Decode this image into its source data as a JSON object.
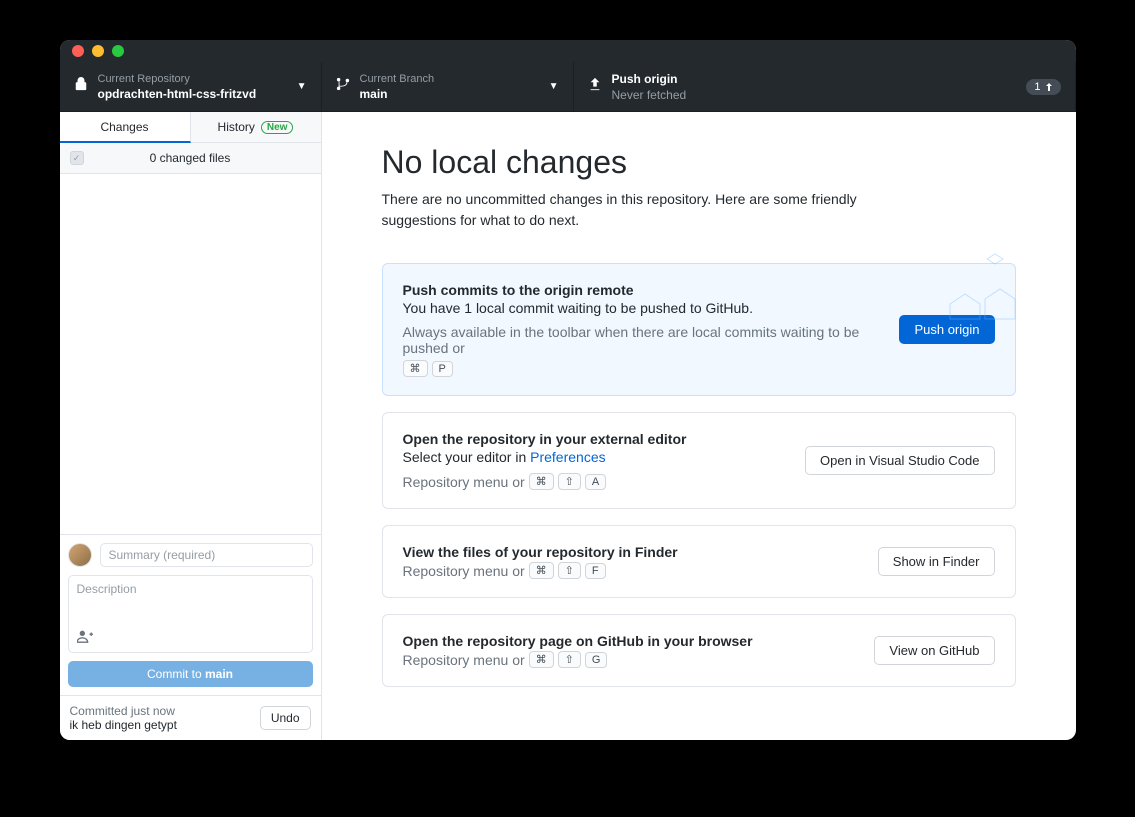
{
  "toolbar": {
    "repo": {
      "label": "Current Repository",
      "value": "opdrachten-html-css-fritzvd"
    },
    "branch": {
      "label": "Current Branch",
      "value": "main"
    },
    "push": {
      "label": "Push origin",
      "status": "Never fetched",
      "badge": "1"
    }
  },
  "sidebar": {
    "tabs": {
      "changes": "Changes",
      "history": "History",
      "new_badge": "New"
    },
    "changes_count": "0 changed files",
    "summary_placeholder": "Summary (required)",
    "description_placeholder": "Description",
    "commit_prefix": "Commit to ",
    "commit_branch": "main",
    "status_line1": "Committed just now",
    "status_line2": "ik heb dingen getypt",
    "undo": "Undo"
  },
  "main": {
    "heading": "No local changes",
    "subheading": "There are no uncommitted changes in this repository. Here are some friendly suggestions for what to do next.",
    "cards": [
      {
        "title": "Push commits to the origin remote",
        "text": "You have 1 local commit waiting to be pushed to GitHub.",
        "hint_prefix": "Always available in the toolbar when there are local commits waiting to be pushed or ",
        "keys": [
          "⌘",
          "P"
        ],
        "button": "Push origin",
        "primary": true
      },
      {
        "title": "Open the repository in your external editor",
        "text_prefix": "Select your editor in ",
        "link": "Preferences",
        "hint_prefix": "Repository menu or ",
        "keys": [
          "⌘",
          "⇧",
          "A"
        ],
        "button": "Open in Visual Studio Code"
      },
      {
        "title": "View the files of your repository in Finder",
        "hint_prefix": "Repository menu or ",
        "keys": [
          "⌘",
          "⇧",
          "F"
        ],
        "button": "Show in Finder"
      },
      {
        "title": "Open the repository page on GitHub in your browser",
        "hint_prefix": "Repository menu or ",
        "keys": [
          "⌘",
          "⇧",
          "G"
        ],
        "button": "View on GitHub"
      }
    ]
  }
}
